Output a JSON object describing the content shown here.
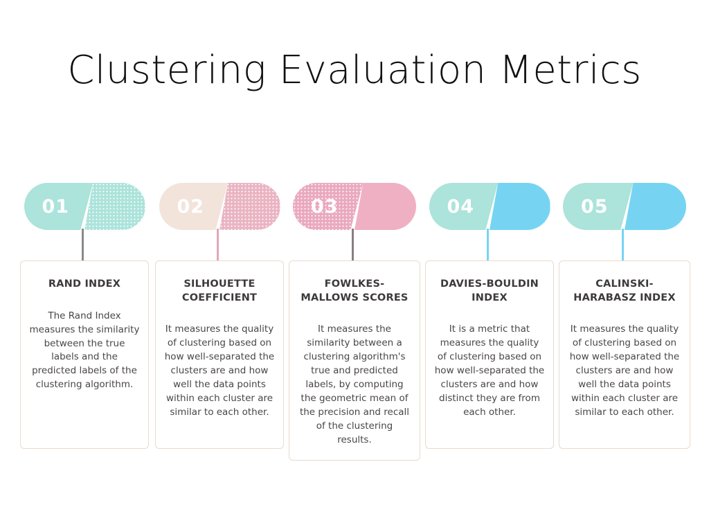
{
  "page": {
    "title": "Clustering Evaluation Metrics",
    "background_color": "#ffffff",
    "title_color": "#111111"
  },
  "palette": {
    "teal": "#ace3db",
    "teal_dots": "#9ad6cd",
    "beige": "#f2e3db",
    "pink": "#efb0c4",
    "pink_dots": "#e8a3b9",
    "blue": "#76d4f2",
    "card_border": "#ead9cd",
    "heading_text": "#3e3a3a",
    "body_text": "#4a4545",
    "number_text": "#ffffff",
    "connector_gray": "#8a8a8a"
  },
  "steps": [
    {
      "number": "01",
      "title": "RAND INDEX",
      "body": "The Rand Index measures the similarity between the true labels and the predicted labels of the clustering algorithm.",
      "left_color": "#ace3db",
      "right_color": "#ace3db",
      "left_pattern": "solid",
      "right_pattern": "dots",
      "dot_color": "#ffffff",
      "connector_color": "#8a8a8a"
    },
    {
      "number": "02",
      "title": "SILHOUETTE COEFFICIENT",
      "body": "It measures the quality of clustering based on how well-separated the clusters are and how well the data points within each cluster are similar to each other.",
      "left_color": "#f2e3db",
      "right_color": "#eab4c3",
      "left_pattern": "solid",
      "right_pattern": "dots",
      "dot_color": "#ffffff",
      "connector_color": "#e2a6b8"
    },
    {
      "number": "03",
      "title": "FOWLKES-MALLOWS SCORES",
      "body": "It measures the similarity between a clustering algorithm's true and predicted labels, by computing the geometric mean of the precision and recall of the clustering results.",
      "left_color": "#eaa9bf",
      "right_color": "#efb0c4",
      "left_pattern": "dots",
      "right_pattern": "solid",
      "dot_color": "#ffffff",
      "connector_color": "#8a7e82"
    },
    {
      "number": "04",
      "title": "DAVIES-BOULDIN INDEX",
      "body": "It is a metric that measures the quality of clustering based on how well-separated the clusters are and how distinct they are from each other.",
      "left_color": "#ace3db",
      "right_color": "#76d4f2",
      "left_pattern": "solid",
      "right_pattern": "solid",
      "dot_color": "#ffffff",
      "connector_color": "#76d4f2"
    },
    {
      "number": "05",
      "title": "CALINSKI-HARABASZ INDEX",
      "body": "It measures the quality of clustering based on how well-separated the clusters are and how well the data points within each cluster are similar to each other.",
      "left_color": "#ace3db",
      "right_color": "#76d4f2",
      "left_pattern": "solid",
      "right_pattern": "solid",
      "dot_color": "#ffffff",
      "connector_color": "#76d4f2"
    }
  ]
}
